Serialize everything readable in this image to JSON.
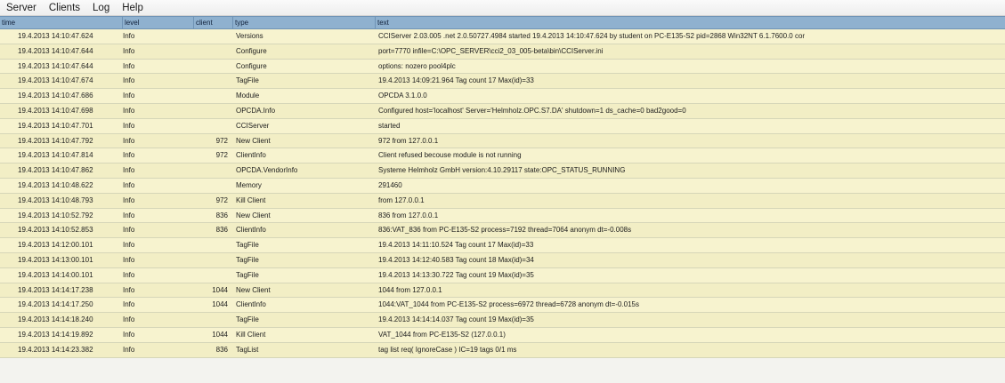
{
  "menu": [
    "Server",
    "Clients",
    "Log",
    "Help"
  ],
  "columns": {
    "time": "time",
    "level": "level",
    "client": "client",
    "type": "type",
    "text": "text"
  },
  "rows": [
    {
      "time": "19.4.2013 14:10:47.624",
      "level": "Info",
      "client": "",
      "type": "Versions",
      "text": "CCIServer 2.03.005 .net 2.0.50727.4984  started 19.4.2013 14:10:47.624 by student on PC-E135-S2 pid=2868 Win32NT 6.1.7600.0 cor"
    },
    {
      "time": "19.4.2013 14:10:47.644",
      "level": "Info",
      "client": "",
      "type": "Configure",
      "text": "port=7770 infile=C:\\OPC_SERVER\\cci2_03_005-beta\\bin\\CCIServer.ini"
    },
    {
      "time": "19.4.2013 14:10:47.644",
      "level": "Info",
      "client": "",
      "type": "Configure",
      "text": "options: nozero pool4plc"
    },
    {
      "time": "19.4.2013 14:10:47.674",
      "level": "Info",
      "client": "",
      "type": "TagFile",
      "text": "19.4.2013 14:09:21.964 Tag count 17 Max(id)=33"
    },
    {
      "time": "19.4.2013 14:10:47.686",
      "level": "Info",
      "client": "",
      "type": "Module",
      "text": "OPCDA 3.1.0.0"
    },
    {
      "time": "19.4.2013 14:10:47.698",
      "level": "Info",
      "client": "",
      "type": "OPCDA.Info",
      "text": "Configured host='localhost' Server='Helmholz.OPC.S7.DA' shutdown=1 ds_cache=0 bad2good=0"
    },
    {
      "time": "19.4.2013 14:10:47.701",
      "level": "Info",
      "client": "",
      "type": "CCIServer",
      "text": "started"
    },
    {
      "time": "19.4.2013 14:10:47.792",
      "level": "Info",
      "client": "972",
      "type": "New Client",
      "text": "972 from 127.0.0.1"
    },
    {
      "time": "19.4.2013 14:10:47.814",
      "level": "Info",
      "client": "972",
      "type": "ClientInfo",
      "text": "Client refused becouse module is not running"
    },
    {
      "time": "19.4.2013 14:10:47.862",
      "level": "Info",
      "client": "",
      "type": "OPCDA.VendorInfo",
      "text": "Systeme Helmholz GmbH version:4.10.29117  state:OPC_STATUS_RUNNING"
    },
    {
      "time": "19.4.2013 14:10:48.622",
      "level": "Info",
      "client": "",
      "type": "Memory",
      "text": "291460"
    },
    {
      "time": "19.4.2013 14:10:48.793",
      "level": "Info",
      "client": "972",
      "type": "Kill Client",
      "text": "from 127.0.0.1"
    },
    {
      "time": "19.4.2013 14:10:52.792",
      "level": "Info",
      "client": "836",
      "type": "New Client",
      "text": "836 from 127.0.0.1"
    },
    {
      "time": "19.4.2013 14:10:52.853",
      "level": "Info",
      "client": "836",
      "type": "ClientInfo",
      "text": "836:VAT_836 from PC-E135-S2 process=7192 thread=7064 anonym dt=-0.008s"
    },
    {
      "time": "19.4.2013 14:12:00.101",
      "level": "Info",
      "client": "",
      "type": "TagFile",
      "text": "19.4.2013 14:11:10.524 Tag count 17 Max(id)=33"
    },
    {
      "time": "19.4.2013 14:13:00.101",
      "level": "Info",
      "client": "",
      "type": "TagFile",
      "text": "19.4.2013 14:12:40.583 Tag count 18 Max(id)=34"
    },
    {
      "time": "19.4.2013 14:14:00.101",
      "level": "Info",
      "client": "",
      "type": "TagFile",
      "text": "19.4.2013 14:13:30.722 Tag count 19 Max(id)=35"
    },
    {
      "time": "19.4.2013 14:14:17.238",
      "level": "Info",
      "client": "1044",
      "type": "New Client",
      "text": "1044 from 127.0.0.1"
    },
    {
      "time": "19.4.2013 14:14:17.250",
      "level": "Info",
      "client": "1044",
      "type": "ClientInfo",
      "text": "1044:VAT_1044 from PC-E135-S2 process=6972 thread=6728 anonym dt=-0.015s"
    },
    {
      "time": "19.4.2013 14:14:18.240",
      "level": "Info",
      "client": "",
      "type": "TagFile",
      "text": "19.4.2013 14:14:14.037 Tag count 19 Max(id)=35"
    },
    {
      "time": "19.4.2013 14:14:19.892",
      "level": "Info",
      "client": "1044",
      "type": "Kill Client",
      "text": "VAT_1044 from PC-E135-S2 (127.0.0.1)"
    },
    {
      "time": "19.4.2013 14:14:23.382",
      "level": "Info",
      "client": "836",
      "type": "TagList",
      "text": "tag list req( IgnoreCase ) IC=19 tags 0/1 ms"
    }
  ]
}
